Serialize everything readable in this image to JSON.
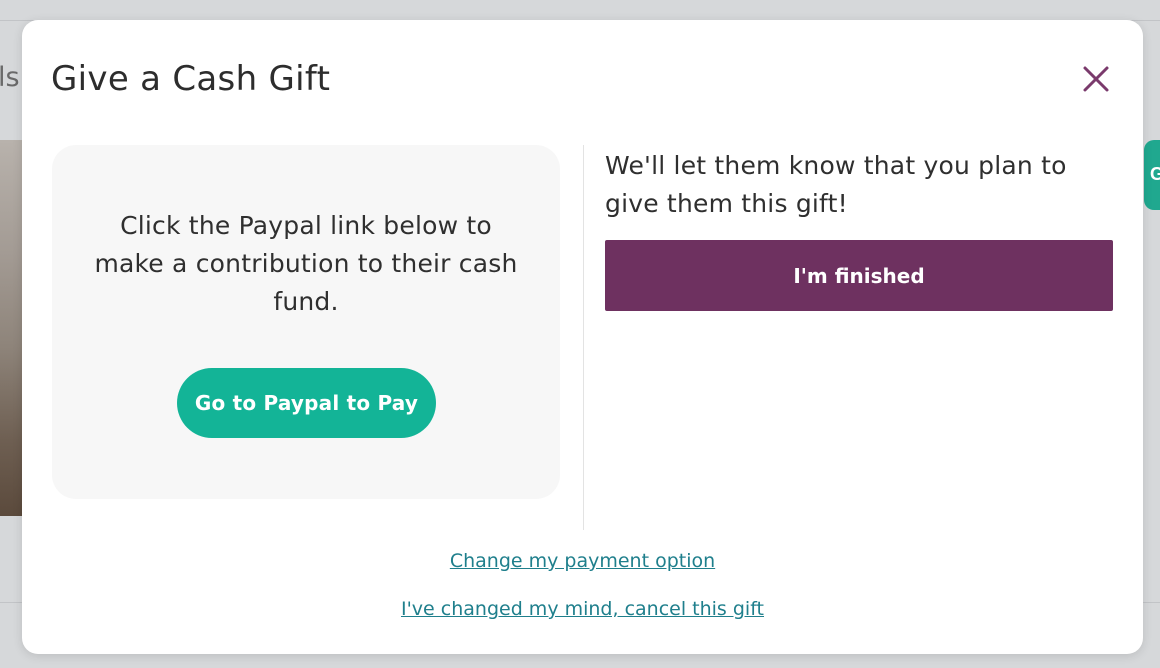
{
  "background": {
    "left_text": "ls",
    "right_tab_letter": "G"
  },
  "modal": {
    "title": "Give a Cash Gift",
    "close_icon": "close-icon",
    "left_panel": {
      "text": "Click the Paypal link below to make a contribution to their cash fund.",
      "button_label": "Go to Paypal to Pay"
    },
    "right_panel": {
      "text": "We'll let them know that you plan to give them this gift!",
      "button_label": "I'm finished"
    },
    "links": {
      "change_payment": "Change my payment option",
      "cancel_gift": "I've changed my mind, cancel this gift"
    }
  },
  "colors": {
    "paypal_button": "#13b497",
    "finished_button": "#6e3160",
    "close_icon": "#7a3a6c",
    "link": "#1f7f8c"
  }
}
